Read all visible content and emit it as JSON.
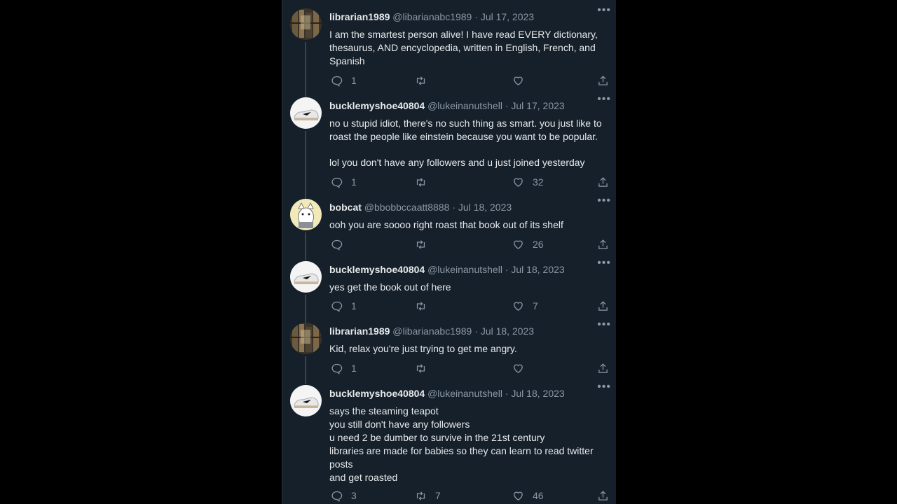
{
  "tweets": [
    {
      "name": "librarian1989",
      "handle": "@libarianabc1989",
      "dot": "·",
      "date": "Jul 17, 2023",
      "avatar": "library-avatar",
      "lines": [
        "I am the smartest person alive! I have read EVERY dictionary, thesaurus, AND encyclopedia, written in English, French, and Spanish"
      ],
      "replies": "1",
      "retweets": "",
      "likes": ""
    },
    {
      "name": "bucklemyshoe40804",
      "handle": "@lukeinanutshell",
      "dot": "·",
      "date": "Jul 17, 2023",
      "avatar": "shoe-avatar",
      "lines": [
        "no u stupid idiot, there's no such thing as smart. you just like to roast the people like einstein because you want to be popular.",
        "",
        "lol you don't have any followers and u just joined yesterday"
      ],
      "replies": "1",
      "retweets": "",
      "likes": "32"
    },
    {
      "name": "bobcat",
      "handle": "@bbobbccaatt8888",
      "dot": "·",
      "date": "Jul 18, 2023",
      "avatar": "cat-avatar",
      "lines": [
        "ooh you are soooo right roast that book out of its shelf"
      ],
      "replies": "",
      "retweets": "",
      "likes": "26"
    },
    {
      "name": "bucklemyshoe40804",
      "handle": "@lukeinanutshell",
      "dot": "·",
      "date": "Jul 18, 2023",
      "avatar": "shoe-avatar",
      "lines": [
        "yes get the book out of here"
      ],
      "replies": "1",
      "retweets": "",
      "likes": "7"
    },
    {
      "name": "librarian1989",
      "handle": "@libarianabc1989",
      "dot": "·",
      "date": "Jul 18, 2023",
      "avatar": "library-avatar",
      "lines": [
        "Kid, relax you're just trying to get me angry."
      ],
      "replies": "1",
      "retweets": "",
      "likes": ""
    },
    {
      "name": "bucklemyshoe40804",
      "handle": "@lukeinanutshell",
      "dot": "·",
      "date": "Jul 18, 2023",
      "avatar": "shoe-avatar",
      "lines": [
        "says the steaming teapot",
        "you still don't have any followers",
        "u need 2 be dumber to survive in the 21st century",
        "libraries are made for babies so they can learn to read twitter posts",
        "and get roasted"
      ],
      "replies": "3",
      "retweets": "7",
      "likes": "46"
    }
  ],
  "more_label": "•••",
  "colors": {
    "background": "#15202b",
    "text": "#e7e9ea",
    "muted": "#8b98a5",
    "thread": "#38444d"
  }
}
